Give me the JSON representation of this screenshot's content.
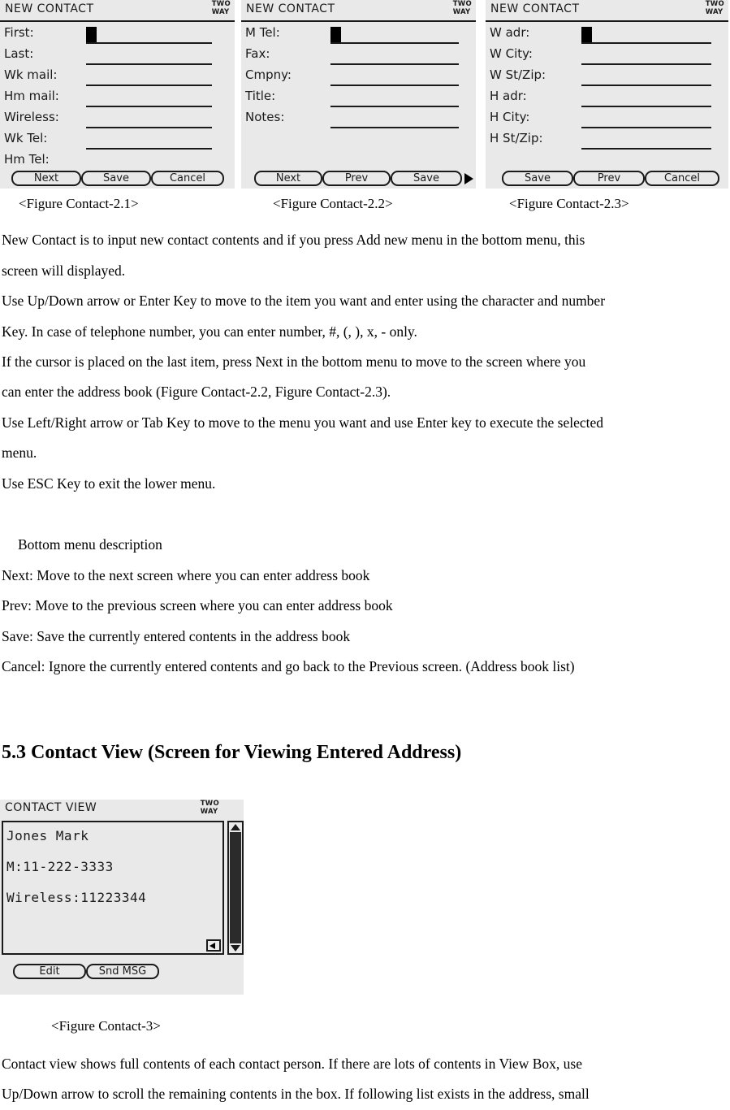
{
  "figures": {
    "new_contact_1": {
      "title": "NEW CONTACT",
      "logo": {
        "line1": "TWO",
        "line2": "WAY"
      },
      "fields": [
        {
          "label": "First:"
        },
        {
          "label": "Last:"
        },
        {
          "label": "Wk mail:"
        },
        {
          "label": "Hm mail:"
        },
        {
          "label": "Wireless:"
        },
        {
          "label": "Wk Tel:"
        },
        {
          "label": "Hm Tel:"
        }
      ],
      "softkeys": [
        "Next",
        "Save",
        "Cancel"
      ]
    },
    "new_contact_2": {
      "title": "NEW CONTACT",
      "logo": {
        "line1": "TWO",
        "line2": "WAY"
      },
      "fields": [
        {
          "label": "M Tel:"
        },
        {
          "label": "Fax:"
        },
        {
          "label": "Cmpny:"
        },
        {
          "label": "Title:"
        },
        {
          "label": "Notes:"
        }
      ],
      "softkeys": [
        "Next",
        "Prev",
        "Save"
      ],
      "more_arrow": "right-arrow-icon"
    },
    "new_contact_3": {
      "title": "NEW CONTACT",
      "logo": {
        "line1": "TWO",
        "line2": "WAY"
      },
      "fields": [
        {
          "label": "W adr:"
        },
        {
          "label": "W City:"
        },
        {
          "label": "W St/Zip:"
        },
        {
          "label": "H adr:"
        },
        {
          "label": "H City:"
        },
        {
          "label": "H St/Zip:"
        }
      ],
      "softkeys": [
        "Save",
        "Prev",
        "Cancel"
      ]
    },
    "contact_view": {
      "title": "CONTACT VIEW",
      "logo": {
        "line1": "TWO",
        "line2": "WAY"
      },
      "lines": [
        "Jones Mark",
        "M:11-222-3333",
        "Wireless:11223344"
      ],
      "softkeys": [
        "Edit",
        "Snd MSG"
      ]
    }
  },
  "captions": {
    "fig_2_1": "<Figure Contact-2.1>",
    "fig_2_2": "<Figure Contact-2.2>",
    "fig_2_3": "<Figure Contact-2.3>",
    "fig_3": "<Figure Contact-3>"
  },
  "body": {
    "p1_line1": "New Contact is to input new contact contents and if you press Add new menu in the bottom menu, this",
    "p1_line2": "screen will displayed.",
    "p2_line1": "Use Up/Down arrow or Enter Key to move to the item you want and enter using the character and number",
    "p2_line2": "Key. In case of telephone number, you can enter number, #, (, ), x, - only.",
    "p3_line1": "If the cursor is placed on the last item, press Next in the bottom menu to move to the screen where you",
    "p3_line2": "can enter the address book (Figure Contact-2.2, Figure Contact-2.3).",
    "p4_line1": "Use Left/Right arrow or Tab Key to move to the menu you want and use Enter key to execute the selected",
    "p4_line2": "menu.",
    "p5_line1": "Use ESC Key to exit the lower menu.",
    "menu_desc_title": "Bottom menu description",
    "menu_next": "Next: Move to the next screen where you can enter address book",
    "menu_prev": "Prev: Move to the previous screen where you can enter address book",
    "menu_save": "Save: Save the currently entered contents in the address book",
    "menu_cancel": "Cancel: Ignore the currently entered contents and go back to the Previous screen. (Address book list)",
    "heading_53": "5.3 Contact View (Screen for Viewing Entered Address)",
    "p6_line1": "Contact view shows full contents of each contact person. If there are lots of contents in View Box, use",
    "p6_line2": "Up/Down arrow to scroll the remaining contents in the box. If following list exists in the address, small"
  }
}
